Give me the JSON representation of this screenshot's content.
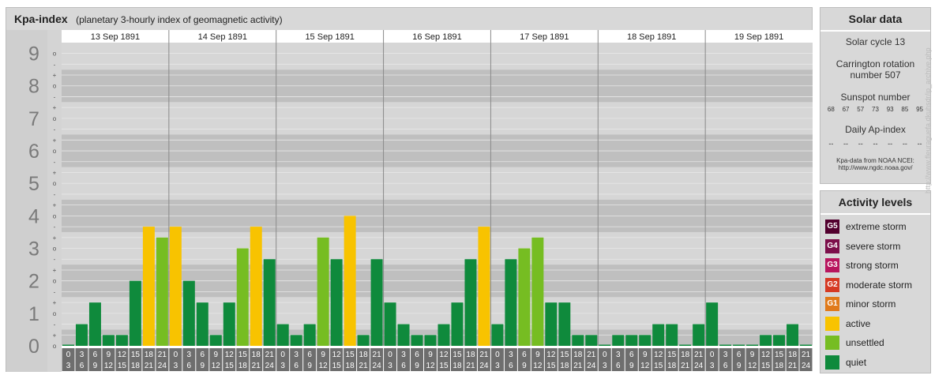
{
  "header": {
    "title": "Kpa-index",
    "subtitle": "(planetary 3-hourly index of geomagnetic activity)"
  },
  "chart_data": {
    "type": "bar",
    "title": "Kpa-index",
    "subtitle": "(planetary 3-hourly index of geomagnetic activity)",
    "ylim": [
      0,
      9.33
    ],
    "y_major_ticks": [
      "0",
      "1",
      "2",
      "3",
      "4",
      "5",
      "6",
      "7",
      "8",
      "9"
    ],
    "y_minor_ticks": [
      "o",
      "+",
      "-",
      "o",
      "+",
      "-",
      "o",
      "+",
      "-",
      "o",
      "+",
      "-",
      "o",
      "+",
      "-",
      "o",
      "+",
      "-",
      "o",
      "+",
      "-",
      "o",
      "+",
      "-",
      "o",
      "+",
      "-",
      "o"
    ],
    "days": [
      "13 Sep 1891",
      "14 Sep 1891",
      "15 Sep 1891",
      "16 Sep 1891",
      "17 Sep 1891",
      "18 Sep 1891",
      "19 Sep 1891"
    ],
    "interval_starts": [
      "0",
      "3",
      "6",
      "9",
      "12",
      "15",
      "18",
      "21"
    ],
    "interval_ends": [
      "3",
      "6",
      "9",
      "12",
      "15",
      "18",
      "21",
      "24"
    ],
    "values": [
      0,
      0.667,
      1.333,
      0.333,
      0.333,
      2,
      3.667,
      3.333,
      3.667,
      2,
      1.333,
      0.333,
      1.333,
      3,
      3.667,
      2.667,
      0.667,
      0.333,
      0.667,
      3.333,
      2.667,
      4,
      0.333,
      2.667,
      1.333,
      0.667,
      0.333,
      0.333,
      0.667,
      1.333,
      2.667,
      3.667,
      0.667,
      2.667,
      3,
      3.333,
      1.333,
      1.333,
      0.333,
      0.333,
      0,
      0.333,
      0.333,
      0.333,
      0.667,
      0.667,
      0,
      0.667,
      1.333,
      0,
      0,
      0,
      0.333,
      0.333,
      0.667,
      0
    ],
    "levels": [
      {
        "name": "quiet",
        "color": "#0f8a3c",
        "max": 2.99
      },
      {
        "name": "unsettled",
        "color": "#76bd22",
        "max": 3.34
      },
      {
        "name": "active",
        "color": "#f8c300",
        "max": 4.34
      },
      {
        "name": "minor storm",
        "color": "#e07a1b",
        "max": 5.34
      }
    ],
    "grid": true
  },
  "solar": {
    "heading": "Solar data",
    "cycle": "Solar cycle 13",
    "carrington_line1": "Carrington rotation",
    "carrington_line2": "number 507",
    "sunspot_heading": "Sunspot number",
    "sunspot_values": [
      "68",
      "67",
      "57",
      "73",
      "93",
      "85",
      "95"
    ],
    "ap_heading": "Daily Ap-index",
    "ap_values": [
      "--",
      "--",
      "--",
      "--",
      "--",
      "--",
      "--"
    ],
    "source_line1": "Kpa-data from NOAA NCEI:",
    "source_line2": "http://www.ngdc.noaa.gov/"
  },
  "activity": {
    "heading": "Activity levels",
    "items": [
      {
        "badge": "G5",
        "label": "extreme storm",
        "color": "#52002e"
      },
      {
        "badge": "G4",
        "label": "severe storm",
        "color": "#7c0f4a"
      },
      {
        "badge": "G3",
        "label": "strong storm",
        "color": "#b8165e"
      },
      {
        "badge": "G2",
        "label": "moderate storm",
        "color": "#d63a24"
      },
      {
        "badge": "G1",
        "label": "minor storm",
        "color": "#e07a1b"
      },
      {
        "badge": "",
        "label": "active",
        "color": "#f8c300"
      },
      {
        "badge": "",
        "label": "unsettled",
        "color": "#76bd22"
      },
      {
        "badge": "",
        "label": "quiet",
        "color": "#0f8a3c"
      }
    ]
  },
  "credit": "http://www.fleuraguefa.dkuhsdr/ip_archive.php"
}
